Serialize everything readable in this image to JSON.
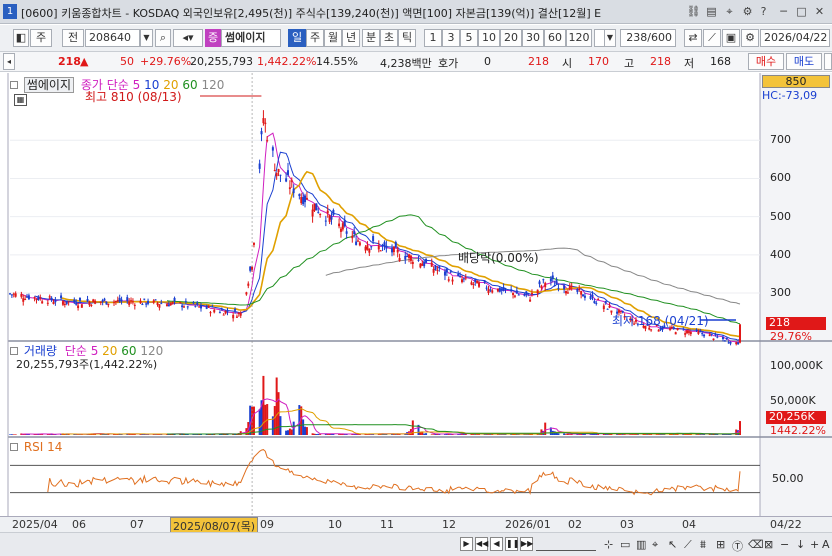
{
  "window": {
    "number": "1",
    "title": "[0600] 키움종합차트 - KOSDAQ 외국인보유[2,495(천)] 주식수[139,240(천)] 액면[100] 자본금[139(억)] 결산[12월] E"
  },
  "toolbar": {
    "jong": "주",
    "jeon": "전",
    "code": "208640",
    "stock_name": "썸에이지",
    "periods": [
      "일",
      "주",
      "월",
      "년",
      "분",
      "초",
      "틱"
    ],
    "active_period": "일",
    "minutes": [
      "1",
      "3",
      "5",
      "10",
      "20",
      "30",
      "60",
      "120"
    ],
    "count": "238/600",
    "date": "2026/04/22"
  },
  "quote": {
    "price": "218",
    "change": "50",
    "change_pct": "+29.76%",
    "volume": "20,255,793",
    "volume_pct": "1,442.22%",
    "turnover": "14.55%",
    "amount": "4,238백만",
    "hoga_label": "호가",
    "hoga_value": "0",
    "ask": "218",
    "open_label": "시",
    "open": "170",
    "high_label": "고",
    "high": "218",
    "low_label": "저",
    "low": "168",
    "buy_label": "매수",
    "sell_label": "매도"
  },
  "chart_data": {
    "type": "candlestick",
    "title": "썸에이지",
    "legend_price": [
      "종가 단순",
      "5",
      "10",
      "20",
      "60",
      "120"
    ],
    "colors": {
      "ma5": "#d020c0",
      "ma10": "#1a3fd0",
      "ma20": "#e0a000",
      "ma60": "#209020",
      "ma120": "#888888",
      "up": "#e01818",
      "down": "#1a3fd0"
    },
    "y_ticks": [
      300,
      400,
      500,
      600,
      700
    ],
    "y_range": [
      190,
      850
    ],
    "y_top_label": "850",
    "hc_label": "HC:-73,09",
    "max_annotation": "최고 810 (08/13)",
    "min_annotation": "최저 168 (04/21)",
    "dividend_annotation": "배당락(0.00%)",
    "current_price_label": "218",
    "current_pct_label": "29.76%",
    "key_points": [
      {
        "date": "2025/04/01",
        "close": 298
      },
      {
        "date": "2025/05/01",
        "close": 276
      },
      {
        "date": "2025/06/01",
        "close": 279
      },
      {
        "date": "2025/07/01",
        "close": 270
      },
      {
        "date": "2025/08/01",
        "close": 245
      },
      {
        "date": "2025/08/07",
        "close": 380
      },
      {
        "date": "2025/08/13",
        "close": 760
      },
      {
        "date": "2025/08/20",
        "close": 620
      },
      {
        "date": "2025/09/01",
        "close": 560
      },
      {
        "date": "2025/10/01",
        "close": 440
      },
      {
        "date": "2025/11/01",
        "close": 390
      },
      {
        "date": "2025/11/15",
        "close": 355
      },
      {
        "date": "2025/12/01",
        "close": 325
      },
      {
        "date": "2026/01/01",
        "close": 290
      },
      {
        "date": "2026/01/10",
        "close": 335
      },
      {
        "date": "2026/02/01",
        "close": 290
      },
      {
        "date": "2026/03/01",
        "close": 215
      },
      {
        "date": "2026/04/01",
        "close": 195
      },
      {
        "date": "2026/04/21",
        "close": 168
      },
      {
        "date": "2026/04/22",
        "close": 218
      }
    ],
    "volume": {
      "legend": [
        "거래량",
        "단순",
        "5",
        "20",
        "60",
        "120"
      ],
      "info": "20,255,793주(1,442.22%)",
      "y_ticks_labels": [
        "100,000K",
        "50,000K"
      ],
      "y_ticks": [
        100000,
        50000
      ],
      "y_range": [
        0,
        125000
      ],
      "current_label": "20,256K",
      "current_pct": "1442.22%",
      "spikes": [
        {
          "date": "2025/08/07",
          "value": 60000
        },
        {
          "date": "2025/08/13",
          "value": 115000
        },
        {
          "date": "2025/08/20",
          "value": 85000
        },
        {
          "date": "2025/09/01",
          "value": 70000
        },
        {
          "date": "2025/11/01",
          "value": 30000
        },
        {
          "date": "2026/01/10",
          "value": 25000
        },
        {
          "date": "2026/04/22",
          "value": 20256
        }
      ]
    },
    "rsi": {
      "legend": "RSI 14",
      "y_tick_label": "50.00",
      "y_tick": 50,
      "levels": [
        70,
        30
      ]
    },
    "x_labels": [
      "2025/04",
      "06",
      "07",
      "2025/08/07(목)",
      "09",
      "10",
      "11",
      "12",
      "2026/01",
      "02",
      "03",
      "04",
      "04/22"
    ]
  }
}
